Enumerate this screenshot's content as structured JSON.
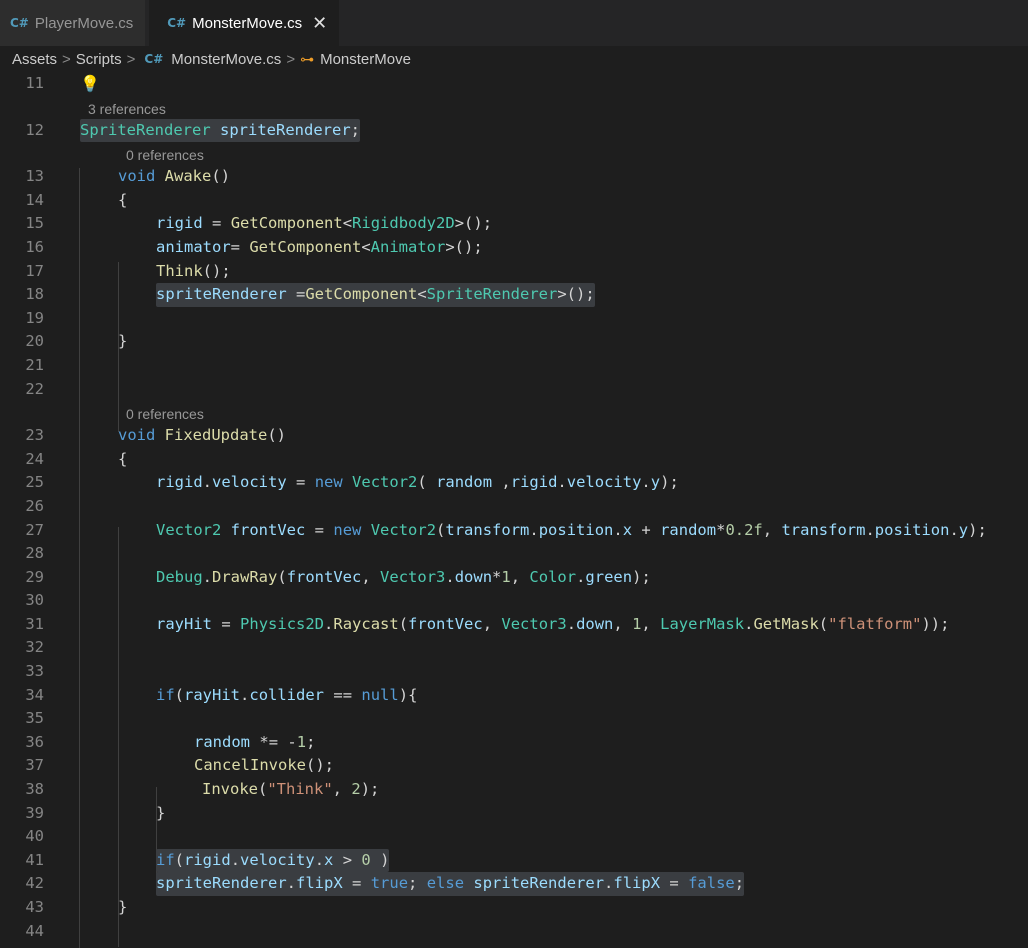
{
  "tabs": [
    {
      "label": "PlayerMove.cs",
      "icon": "csharp-icon",
      "active": false
    },
    {
      "label": "MonsterMove.cs",
      "icon": "csharp-icon",
      "active": true
    }
  ],
  "tab_close_glyph": "✕",
  "breadcrumb": {
    "items": [
      "Assets",
      "Scripts",
      "MonsterMove.cs",
      "MonsterMove"
    ],
    "separator": ">"
  },
  "icons": {
    "csharp": "C#",
    "class": "⊶",
    "bulb": "💡"
  },
  "colors": {
    "editor_bg": "#1e1e1e",
    "keyword": "#569cd6",
    "type": "#4ec9b0",
    "variable": "#9cdcfe",
    "function": "#dcdcaa",
    "string": "#ce9178",
    "number": "#b5cea8"
  },
  "lines": [
    {
      "num": "11",
      "kind": "code",
      "text": ""
    },
    {
      "kind": "lens",
      "text": "3 references"
    },
    {
      "num": "12",
      "kind": "code",
      "text": "SpriteRenderer spriteRenderer;"
    },
    {
      "kind": "lens",
      "text": "0 references"
    },
    {
      "num": "13",
      "kind": "code",
      "text": "void Awake()"
    },
    {
      "num": "14",
      "kind": "code",
      "text": "{"
    },
    {
      "num": "15",
      "kind": "code",
      "text": "rigid = GetComponent<Rigidbody2D>();"
    },
    {
      "num": "16",
      "kind": "code",
      "text": "animator= GetComponent<Animator>();"
    },
    {
      "num": "17",
      "kind": "code",
      "text": "Think();"
    },
    {
      "num": "18",
      "kind": "code",
      "text": "spriteRenderer =GetComponent<SpriteRenderer>();"
    },
    {
      "num": "19",
      "kind": "code",
      "text": ""
    },
    {
      "num": "20",
      "kind": "code",
      "text": "}"
    },
    {
      "num": "21",
      "kind": "code",
      "text": ""
    },
    {
      "num": "22",
      "kind": "code",
      "text": ""
    },
    {
      "kind": "lens",
      "text": "0 references"
    },
    {
      "num": "23",
      "kind": "code",
      "text": "void FixedUpdate()"
    },
    {
      "num": "24",
      "kind": "code",
      "text": "{"
    },
    {
      "num": "25",
      "kind": "code",
      "text": "rigid.velocity = new Vector2( random ,rigid.velocity.y);"
    },
    {
      "num": "26",
      "kind": "code",
      "text": ""
    },
    {
      "num": "27",
      "kind": "code",
      "text": "Vector2 frontVec = new Vector2(transform.position.x + random*0.2f, transform.position.y);"
    },
    {
      "num": "28",
      "kind": "code",
      "text": ""
    },
    {
      "num": "29",
      "kind": "code",
      "text": "Debug.DrawRay(frontVec, Vector3.down*1, Color.green);"
    },
    {
      "num": "30",
      "kind": "code",
      "text": ""
    },
    {
      "num": "31",
      "kind": "code",
      "text": "rayHit = Physics2D.Raycast(frontVec, Vector3.down, 1, LayerMask.GetMask(\"flatform\"));"
    },
    {
      "num": "32",
      "kind": "code",
      "text": ""
    },
    {
      "num": "33",
      "kind": "code",
      "text": ""
    },
    {
      "num": "34",
      "kind": "code",
      "text": "if(rayHit.collider == null){"
    },
    {
      "num": "35",
      "kind": "code",
      "text": ""
    },
    {
      "num": "36",
      "kind": "code",
      "text": "random *= -1;"
    },
    {
      "num": "37",
      "kind": "code",
      "text": "CancelInvoke();"
    },
    {
      "num": "38",
      "kind": "code",
      "text": "Invoke(\"Think\", 2);"
    },
    {
      "num": "39",
      "kind": "code",
      "text": "}"
    },
    {
      "num": "40",
      "kind": "code",
      "text": ""
    },
    {
      "num": "41",
      "kind": "code",
      "text": "if(rigid.velocity.x > 0 )"
    },
    {
      "num": "42",
      "kind": "code",
      "text": "spriteRenderer.flipX = true; else spriteRenderer.flipX = false;"
    },
    {
      "num": "43",
      "kind": "code",
      "text": "}"
    },
    {
      "num": "44",
      "kind": "code",
      "text": ""
    }
  ]
}
